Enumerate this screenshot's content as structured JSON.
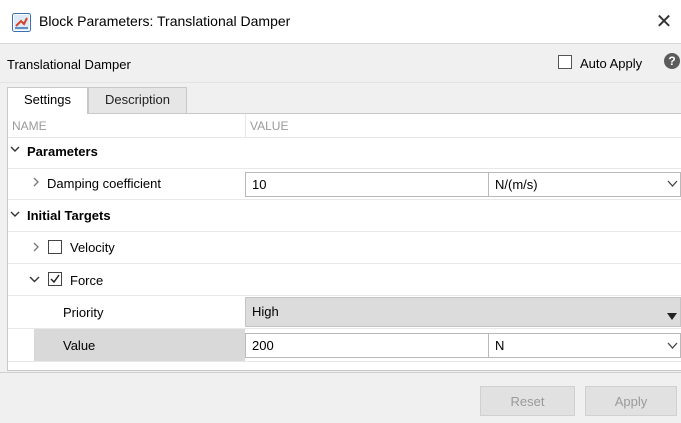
{
  "window": {
    "title": "Block Parameters: Translational Damper",
    "close_glyph": "✕"
  },
  "header": {
    "block_name": "Translational Damper",
    "auto_apply_label": "Auto Apply",
    "help_glyph": "?"
  },
  "tabs": [
    {
      "label": "Settings",
      "active": true
    },
    {
      "label": "Description",
      "active": false
    }
  ],
  "table": {
    "columns": [
      "NAME",
      "VALUE"
    ],
    "sections": {
      "parameters": {
        "label": "Parameters",
        "damping": {
          "label": "Damping coefficient",
          "value": "10",
          "unit": "N/(m/s)"
        }
      },
      "initial_targets": {
        "label": "Initial Targets",
        "velocity": {
          "label": "Velocity",
          "checked": false
        },
        "force": {
          "label": "Force",
          "checked": true,
          "priority": {
            "label": "Priority",
            "value": "High"
          },
          "value": {
            "label": "Value",
            "value": "200",
            "unit": "N"
          }
        }
      }
    }
  },
  "footer": {
    "reset_label": "Reset",
    "apply_label": "Apply"
  },
  "icons": {
    "expanded": "expand-chevron-down",
    "collapsed": "expand-chevron-right",
    "dropdown": "dropdown-chevron",
    "check": "checkmark"
  },
  "colors": {
    "selected_row": "#d9d9d9",
    "disabled_button_text": "#9a9a9a"
  }
}
